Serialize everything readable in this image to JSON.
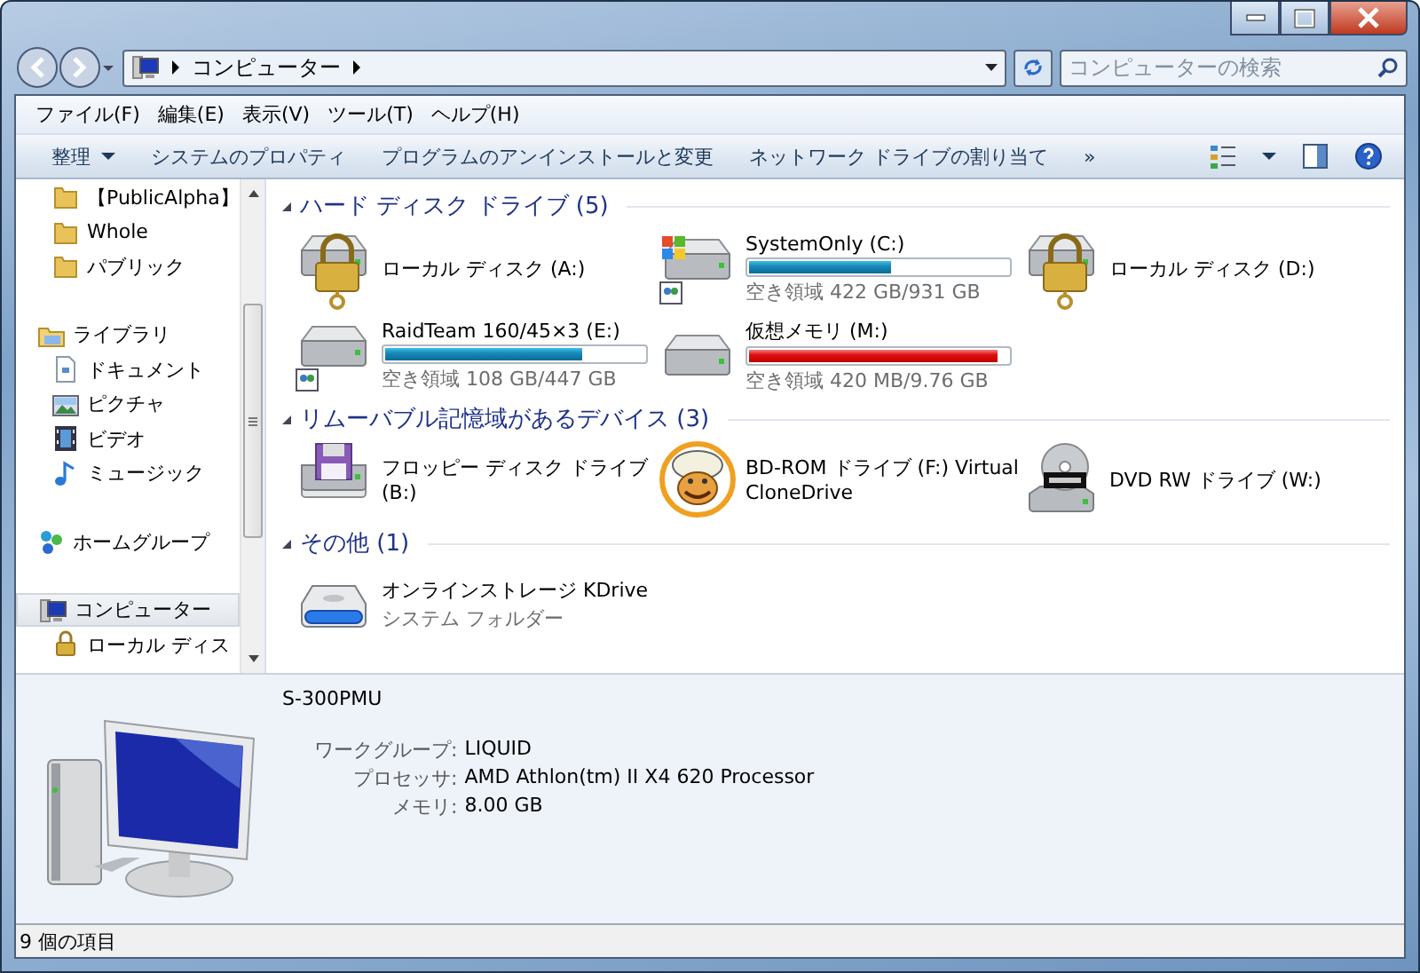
{
  "address": {
    "path": [
      "コンピューター"
    ],
    "search_placeholder": "コンピューターの検索"
  },
  "menu": [
    "ファイル(F)",
    "編集(E)",
    "表示(V)",
    "ツール(T)",
    "ヘルプ(H)"
  ],
  "toolbar": {
    "organize": "整理",
    "commands": [
      "システムのプロパティ",
      "プログラムのアンインストールと変更",
      "ネットワーク ドライブの割り当て"
    ],
    "more": "»"
  },
  "sidebar": {
    "sections": [
      {
        "children": [
          {
            "label": "【PublicAlpha】",
            "kind": "folder",
            "selected": false
          },
          {
            "label": "Whole",
            "kind": "folder",
            "selected": false
          },
          {
            "label": "パブリック",
            "kind": "folder",
            "selected": false
          }
        ]
      },
      {
        "label": "ライブラリ",
        "kind": "library",
        "selected": false,
        "children": [
          {
            "label": "ドキュメント",
            "kind": "document",
            "selected": false
          },
          {
            "label": "ピクチャ",
            "kind": "picture",
            "selected": false
          },
          {
            "label": "ビデオ",
            "kind": "video",
            "selected": false
          },
          {
            "label": "ミュージック",
            "kind": "music",
            "selected": false
          }
        ]
      },
      {
        "label": "ホームグループ",
        "kind": "homegroup",
        "selected": false
      },
      {
        "label": "コンピューター",
        "kind": "computer",
        "selected": true,
        "children": [
          {
            "label": "ローカル ディス",
            "kind": "lockdisk",
            "selected": false
          }
        ]
      }
    ]
  },
  "groups": [
    {
      "title": "ハード ディスク ドライブ (5)",
      "items": [
        {
          "name": "ローカル ディスク (A:)",
          "kind": "locked"
        },
        {
          "name": "SystemOnly (C:)",
          "kind": "system",
          "level": 0.55,
          "critical": false,
          "free": "空き領域 422 GB/931 GB"
        },
        {
          "name": "ローカル ディスク (D:)",
          "kind": "locked"
        },
        {
          "name": "RaidTeam 160/45×3 (E:)",
          "kind": "shared",
          "level": 0.76,
          "critical": false,
          "free": "空き領域 108 GB/447 GB"
        },
        {
          "name": "仮想メモリ (M:)",
          "kind": "disk",
          "level": 0.96,
          "critical": true,
          "free": "空き領域 420 MB/9.76 GB"
        }
      ]
    },
    {
      "title": "リムーバブル記憶域があるデバイス (3)",
      "items": [
        {
          "name": "フロッピー ディスク ドライブ (B:)",
          "kind": "floppy"
        },
        {
          "name": "BD-ROM ドライブ (F:) Virtual CloneDrive",
          "kind": "virtual"
        },
        {
          "name": "DVD RW ドライブ (W:)",
          "kind": "dvd"
        }
      ]
    },
    {
      "title": "その他 (1)",
      "items": [
        {
          "name": "オンラインストレージ KDrive",
          "kind": "online",
          "sub": "システム フォルダー"
        }
      ]
    }
  ],
  "details": {
    "name": "S-300PMU",
    "fields": [
      {
        "label": "ワークグループ:",
        "value": "LIQUID"
      },
      {
        "label": "プロセッサ:",
        "value": "AMD Athlon(tm) II X4 620 Processor"
      },
      {
        "label": "メモリ:",
        "value": "8.00 GB"
      }
    ]
  },
  "status_bar": "9 個の項目"
}
